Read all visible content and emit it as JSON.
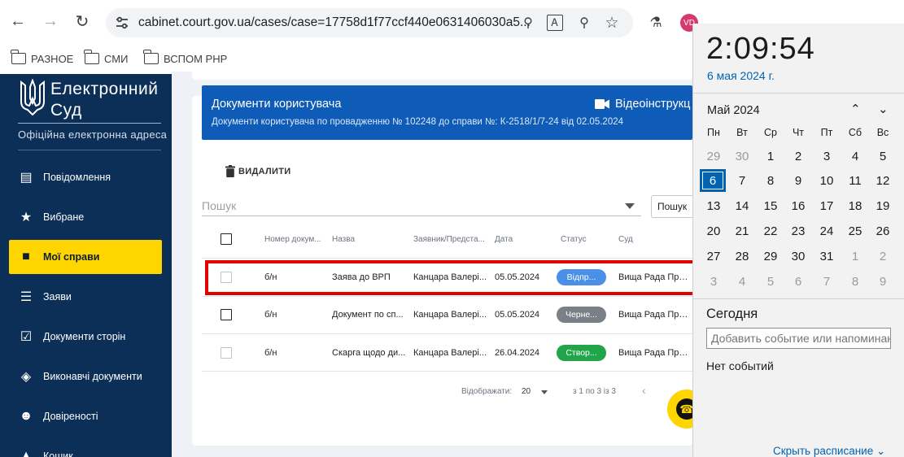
{
  "browser": {
    "url": "cabinet.court.gov.ua/cases/case=17758d1f77ccf440e0631406030a5...",
    "profile_initials": "VD",
    "bookmarks": [
      {
        "label": "РАЗНОЕ"
      },
      {
        "label": "СМИ"
      },
      {
        "label": "ВСПОМ PHP"
      }
    ]
  },
  "sidebar": {
    "logo_line1": "Електронний",
    "logo_line2": "Суд",
    "logo_subtitle": "Офіційна електронна адреса",
    "items": [
      {
        "label": "Повідомлення",
        "icon": "message-icon"
      },
      {
        "label": "Вибране",
        "icon": "star-icon"
      },
      {
        "label": "Мої справи",
        "icon": "folder-icon",
        "active": true
      },
      {
        "label": "Заяви",
        "icon": "list-icon"
      },
      {
        "label": "Документи сторін",
        "icon": "checklist-icon"
      },
      {
        "label": "Виконавчі документи",
        "icon": "layers-icon"
      },
      {
        "label": "Довіреності",
        "icon": "people-icon"
      },
      {
        "label": "Кошик",
        "icon": "trash-icon"
      }
    ]
  },
  "main": {
    "banner_title": "Документи користувача",
    "banner_subtitle": "Документи користувача по провадженню № 102248 до справи №: К-2518/1/7-24 від 02.05.2024",
    "video_label": "Відеоінструкц",
    "delete_label": "ВИДАЛИТИ",
    "search_placeholder": "Пошук",
    "search_button": "Пошук",
    "columns": [
      "Номер докум...",
      "Назва",
      "Заявник/Предста...",
      "Дата",
      "Статус",
      "Суд"
    ],
    "rows": [
      {
        "number": "б/н",
        "name": "Заява до ВРП",
        "applicant": "Канцара Валері...",
        "date": "05.05.2024",
        "status": "Відпр...",
        "court": "Вища Рада Пра..."
      },
      {
        "number": "б/н",
        "name": "Документ по сп...",
        "applicant": "Канцара Валері...",
        "date": "05.05.2024",
        "status": "Черне...",
        "court": "Вища Рада Пра..."
      },
      {
        "number": "б/н",
        "name": "Скарга щодо ди...",
        "applicant": "Канцара Валері...",
        "date": "26.04.2024",
        "status": "Створ...",
        "court": "Вища Рада Пра..."
      }
    ],
    "status_colors": [
      "#4a8fe8",
      "#7a8088",
      "#22a44a"
    ],
    "highlight_color": "#e00000",
    "pager_label": "Відображати:",
    "pager_value": "20",
    "pager_range": "з 1 по 3 із 3"
  },
  "calendar": {
    "time": "2:09:54",
    "date": "6 мая 2024 г.",
    "month": "Май 2024",
    "weekdays": [
      "Пн",
      "Вт",
      "Ср",
      "Чт",
      "Пт",
      "Сб",
      "Вс"
    ],
    "days": [
      "29",
      "30",
      "1",
      "2",
      "3",
      "4",
      "5",
      "6",
      "7",
      "8",
      "9",
      "10",
      "11",
      "12",
      "13",
      "14",
      "15",
      "16",
      "17",
      "18",
      "19",
      "20",
      "21",
      "22",
      "23",
      "24",
      "25",
      "26",
      "27",
      "28",
      "29",
      "30",
      "31",
      "1",
      "2",
      "3",
      "4",
      "5",
      "6",
      "7",
      "8",
      "9"
    ],
    "today_label": "Сегодня",
    "event_placeholder": "Добавить событие или напоминание",
    "no_events": "Нет событий",
    "hide_schedule": "Скрыть расписание"
  }
}
